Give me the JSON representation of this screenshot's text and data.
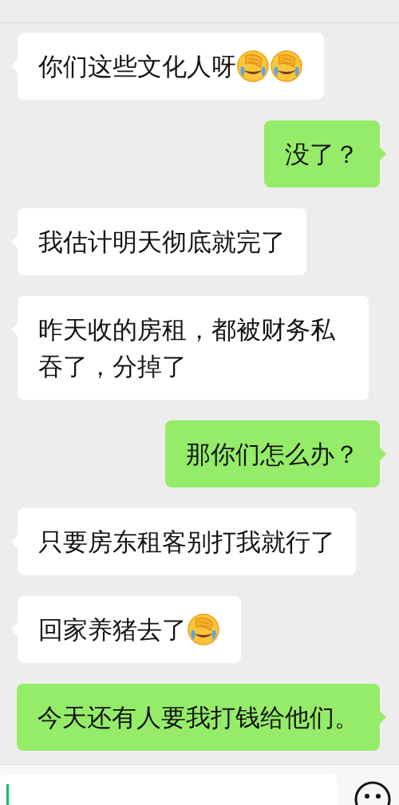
{
  "messages": [
    {
      "kind": "received",
      "parts": [
        {
          "kind": "text",
          "text": "你们这些文化人呀"
        },
        {
          "kind": "emoji"
        },
        {
          "kind": "emoji"
        }
      ]
    },
    {
      "kind": "sent",
      "parts": [
        {
          "kind": "text",
          "text": "没了？"
        }
      ]
    },
    {
      "kind": "received",
      "parts": [
        {
          "kind": "text",
          "text": "我估计明天彻底就完了"
        }
      ]
    },
    {
      "kind": "received",
      "parts": [
        {
          "kind": "text",
          "text": "昨天收的房租，都被财务私吞了，分掉了"
        }
      ]
    },
    {
      "kind": "sent",
      "parts": [
        {
          "kind": "text",
          "text": "那你们怎么办？"
        }
      ]
    },
    {
      "kind": "received",
      "parts": [
        {
          "kind": "text",
          "text": "只要房东租客别打我就行了"
        }
      ]
    },
    {
      "kind": "received",
      "parts": [
        {
          "kind": "text",
          "text": "回家养猪去了"
        },
        {
          "kind": "emoji"
        }
      ]
    },
    {
      "kind": "sent",
      "parts": [
        {
          "kind": "text",
          "text": "今天还有人要我打钱给他们。"
        }
      ]
    }
  ]
}
